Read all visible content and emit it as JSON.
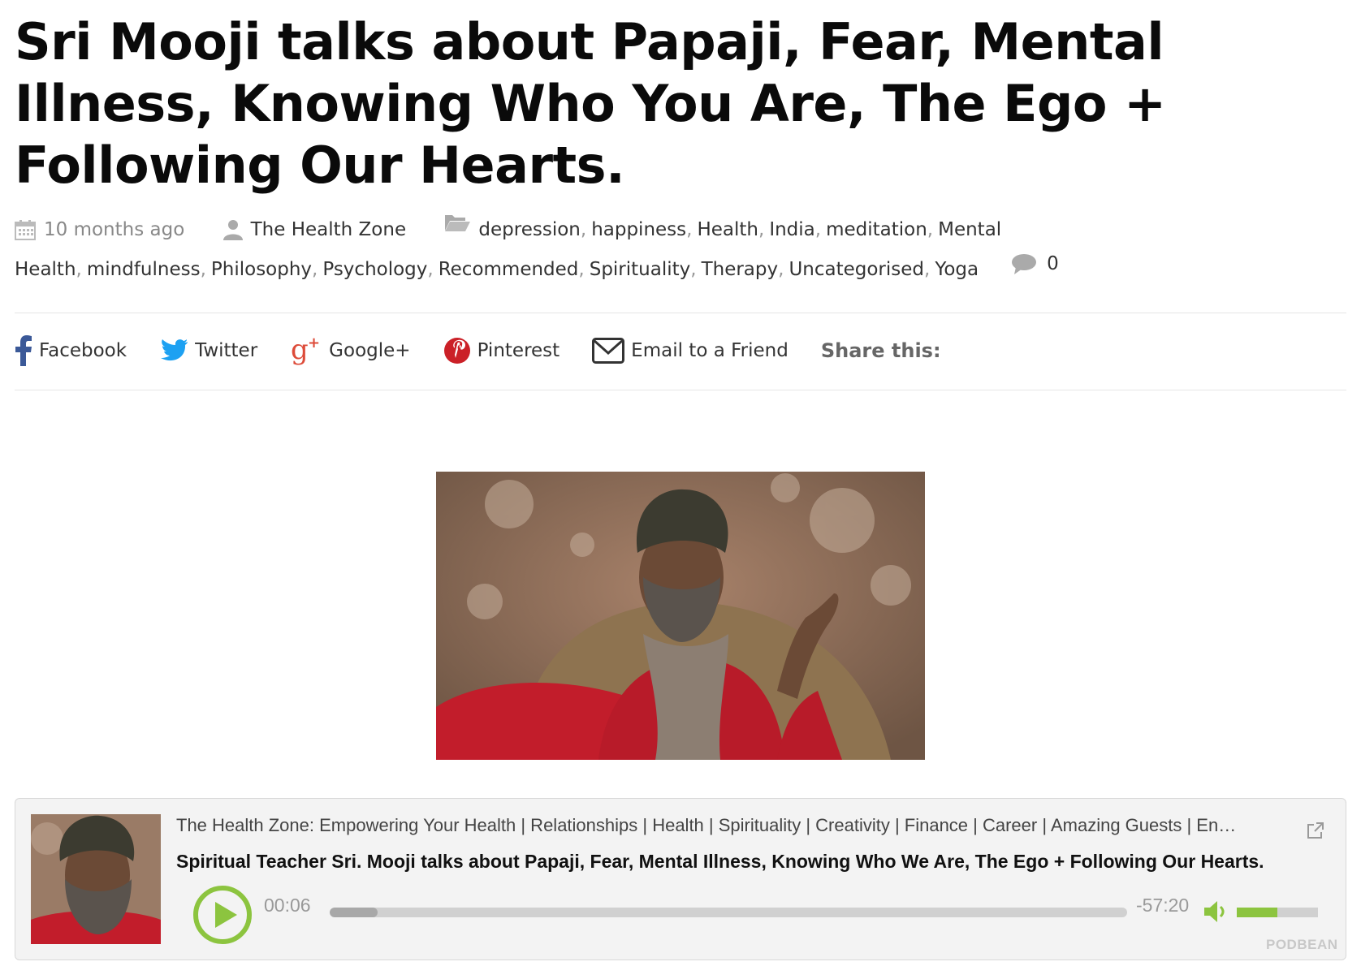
{
  "post": {
    "title": "Sri Mooji talks about Papaji, Fear, Mental Illness, Knowing Who You Are, The Ego + Following Our Hearts."
  },
  "meta": {
    "date": "10 months ago",
    "author": "The Health Zone",
    "categories": [
      "depression",
      "happiness",
      "Health",
      "India",
      "meditation",
      "Mental Health",
      "mindfulness",
      "Philosophy",
      "Psychology",
      "Recommended",
      "Spirituality",
      "Therapy",
      "Uncategorised",
      "Yoga"
    ],
    "comment_count": "0",
    "icons": {
      "date": "calendar-icon",
      "author": "user-icon",
      "categories": "folder-icon",
      "comments": "comment-bubble-icon"
    }
  },
  "share": {
    "facebook": "Facebook",
    "twitter": "Twitter",
    "googleplus": "Google+",
    "pinterest": "Pinterest",
    "email": "Email to a Friend",
    "title": "Share this:",
    "colors": {
      "facebook": "#3b5998",
      "twitter": "#1da1f2",
      "googleplus": "#dd4b39",
      "pinterest": "#cb2027",
      "email": "#333333"
    }
  },
  "player": {
    "podcast_name": "The Health Zone: Empowering Your Health | Relationships | Health | Spirituality | Creativity | Finance | Career | Amazing Guests | Engaging Conversations",
    "episode_title": "Spiritual Teacher Sri. Mooji talks about Papaji, Fear, Mental Illness, Knowing Who We Are, The Ego + Following Our Hearts.",
    "current_time": "00:06",
    "remaining_time": "-57:20",
    "progress_percent": 6,
    "volume_percent": 50,
    "brand": "PODBEAN",
    "accent_color": "#8cc43f"
  }
}
